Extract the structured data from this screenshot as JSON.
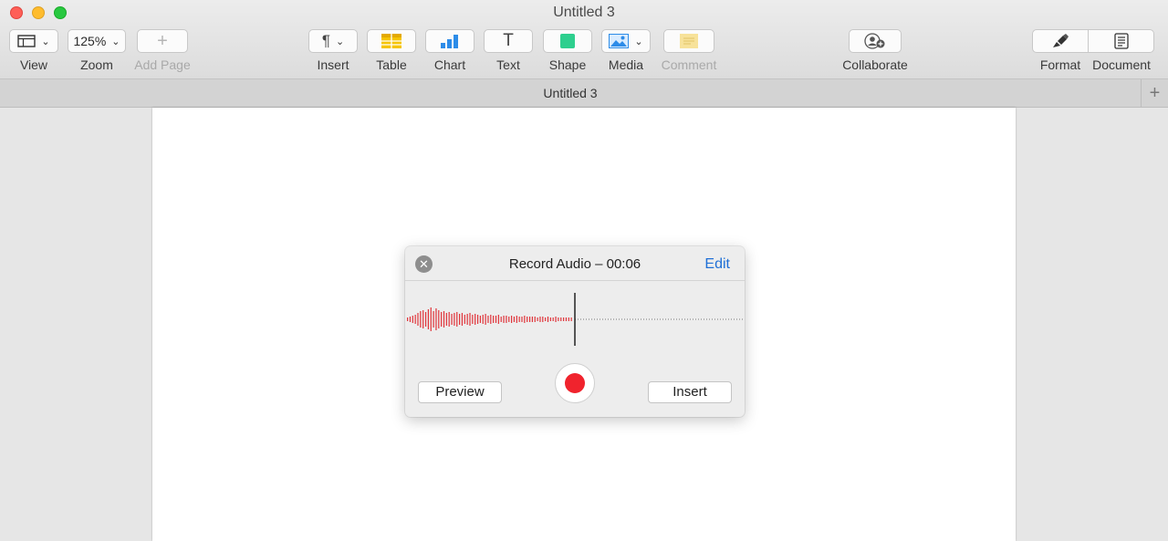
{
  "window": {
    "title": "Untitled 3"
  },
  "toolbar": {
    "view": {
      "label": "View",
      "icon": "sidebar-layout-icon"
    },
    "zoom": {
      "label": "Zoom",
      "value": "125%"
    },
    "add_page": {
      "label": "Add Page",
      "icon": "plus-icon"
    },
    "insert": {
      "label": "Insert",
      "icon": "pilcrow-icon",
      "glyph": "¶"
    },
    "table": {
      "label": "Table",
      "icon": "table-icon",
      "color": "#f5c400"
    },
    "chart": {
      "label": "Chart",
      "icon": "bar-chart-icon",
      "color": "#2d8ce8"
    },
    "text": {
      "label": "Text",
      "icon": "text-icon",
      "glyph": "T"
    },
    "shape": {
      "label": "Shape",
      "icon": "square-shape-icon",
      "color": "#2ecf8e"
    },
    "media": {
      "label": "Media",
      "icon": "photo-icon",
      "color": "#2d8ce8"
    },
    "comment": {
      "label": "Comment",
      "icon": "comment-note-icon",
      "color": "#f7e29a"
    },
    "collaborate": {
      "label": "Collaborate",
      "icon": "add-person-icon"
    },
    "format": {
      "label": "Format",
      "icon": "paintbrush-icon"
    },
    "document": {
      "label": "Document",
      "icon": "document-icon"
    }
  },
  "tab": {
    "title": "Untitled 3",
    "add_glyph": "+"
  },
  "record_audio": {
    "title": "Record Audio – 00:06",
    "edit_label": "Edit",
    "close_glyph": "✕",
    "preview_label": "Preview",
    "insert_label": "Insert",
    "record_color": "#f0232d",
    "waveform_color": "#e0343a"
  }
}
